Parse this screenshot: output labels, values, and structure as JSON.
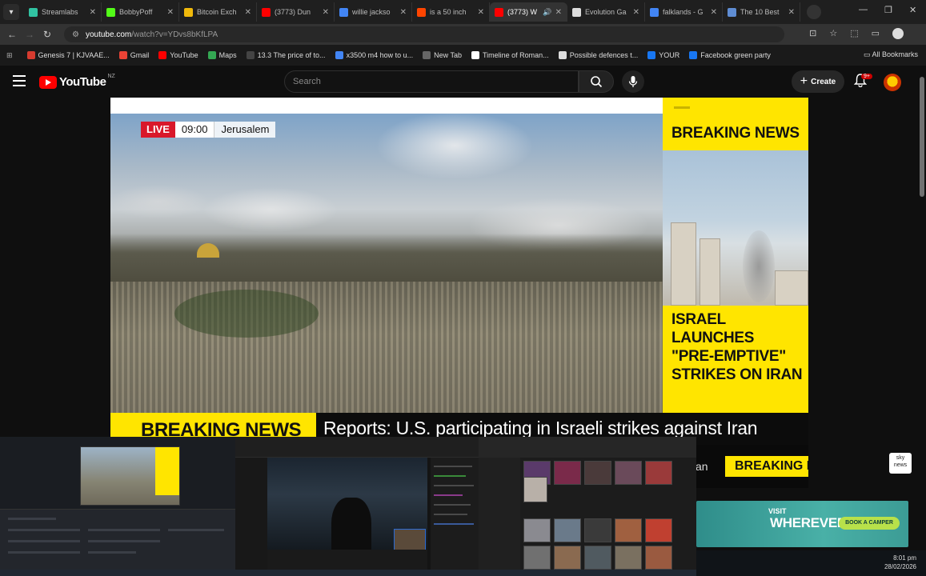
{
  "browser": {
    "tabs": [
      {
        "label": "Streamlabs",
        "color": "#31c3a2",
        "active": false
      },
      {
        "label": "BobbyPoff",
        "color": "#53fc18",
        "active": false
      },
      {
        "label": "Bitcoin Exch",
        "color": "#f0b90b",
        "active": false
      },
      {
        "label": "(3773) Dun",
        "color": "#ff0000",
        "active": false
      },
      {
        "label": "willie jackso",
        "color": "#4285f4",
        "active": false
      },
      {
        "label": "is a 50 inch",
        "color": "#ff4500",
        "active": false
      },
      {
        "label": "(3773) W",
        "color": "#ff0000",
        "active": true
      },
      {
        "label": "Evolution Ga",
        "color": "#dddddd",
        "active": false
      },
      {
        "label": "falklands - G",
        "color": "#4285f4",
        "active": false
      },
      {
        "label": "The 10 Best",
        "color": "#5f8dd3",
        "active": false
      }
    ],
    "url_host": "youtube.com",
    "url_path": "/watch?v=YDvs8bKfLPA",
    "bookmarks": [
      {
        "label": "Genesis 7 | KJVAAE...",
        "color": "#d63b2f"
      },
      {
        "label": "Gmail",
        "color": "#ea4335"
      },
      {
        "label": "YouTube",
        "color": "#ff0000"
      },
      {
        "label": "Maps",
        "color": "#34a853"
      },
      {
        "label": "13.3 The price of to...",
        "color": "#444444"
      },
      {
        "label": "x3500 m4 how to u...",
        "color": "#4285f4"
      },
      {
        "label": "New Tab",
        "color": "#666666"
      },
      {
        "label": "Timeline of Roman...",
        "color": "#ffffff"
      },
      {
        "label": "Possible defences t...",
        "color": "#dddddd"
      },
      {
        "label": "YOUR",
        "color": "#1877f2"
      },
      {
        "label": "Facebook green party",
        "color": "#1877f2"
      }
    ],
    "all_bookmarks": "All Bookmarks"
  },
  "youtube": {
    "logo_text": "YouTube",
    "region": "NZ",
    "search_placeholder": "Search",
    "create_label": "Create",
    "notification_count": "9+"
  },
  "video": {
    "live_label": "LIVE",
    "time": "09:00",
    "location": "Jerusalem",
    "side_breaking": "BREAKING NEWS",
    "side_headline": [
      "ISRAEL",
      "LAUNCHES",
      "\"PRE-EMPTIVE\"",
      "STRIKES ON IRAN"
    ],
    "ticker_breaking": "BREAKING NEWS",
    "ticker_text": "Reports: U.S. participating in Israeli strikes against Iran",
    "strap_breaking": "BREAKING N",
    "strap_an": "an",
    "channel_logo": "sky news"
  },
  "ad": {
    "visit": "VISIT",
    "wherever": "WHEREVER",
    "cta": "BOOK A CAMPER"
  },
  "taskbar": {
    "time": "8:01 pm",
    "date": "28/02/2026"
  }
}
